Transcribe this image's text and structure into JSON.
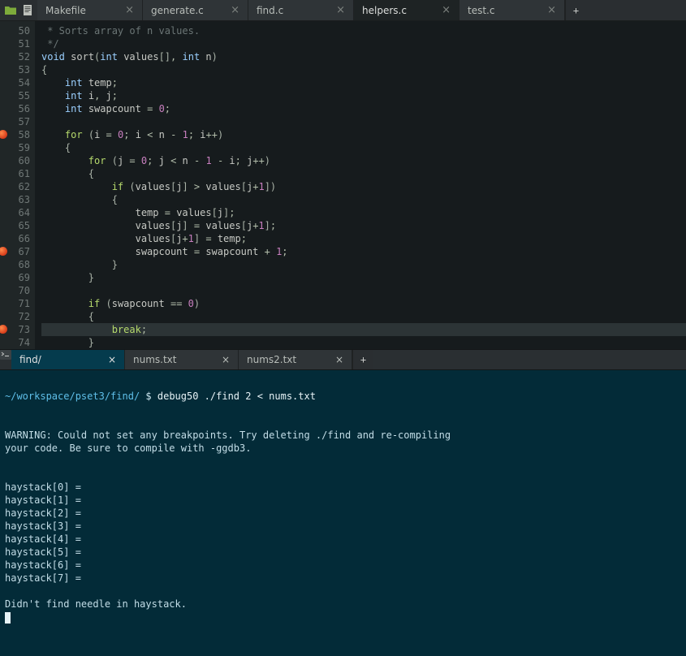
{
  "editorTabs": {
    "items": [
      {
        "label": "Makefile",
        "active": false
      },
      {
        "label": "generate.c",
        "active": false
      },
      {
        "label": "find.c",
        "active": false
      },
      {
        "label": "helpers.c",
        "active": true
      },
      {
        "label": "test.c",
        "active": false
      }
    ],
    "closeGlyph": "×",
    "addGlyph": "+"
  },
  "code": {
    "startLine": 50,
    "lines": [
      {
        "n": 50,
        "bp": false,
        "hl": false,
        "html": "<span class='c-comment'> * Sorts array of n values.</span>"
      },
      {
        "n": 51,
        "bp": false,
        "hl": false,
        "html": "<span class='c-comment'> */</span>"
      },
      {
        "n": 52,
        "bp": false,
        "hl": false,
        "html": "<span class='c-type'>void</span> <span class='c-id'>sort</span><span class='c-paren'>(</span><span class='c-type'>int</span> <span class='c-id'>values</span><span class='c-paren'>[</span><span class='c-paren'>]</span><span class='c-op'>,</span> <span class='c-type'>int</span> <span class='c-id'>n</span><span class='c-paren'>)</span>"
      },
      {
        "n": 53,
        "bp": false,
        "hl": false,
        "html": "<span class='c-paren'>{</span>"
      },
      {
        "n": 54,
        "bp": false,
        "hl": false,
        "html": "    <span class='c-type'>int</span> <span class='c-id'>temp</span><span class='c-op'>;</span>"
      },
      {
        "n": 55,
        "bp": false,
        "hl": false,
        "html": "    <span class='c-type'>int</span> <span class='c-id'>i</span><span class='c-op'>,</span> <span class='c-id'>j</span><span class='c-op'>;</span>"
      },
      {
        "n": 56,
        "bp": false,
        "hl": false,
        "html": "    <span class='c-type'>int</span> <span class='c-id'>swapcount</span> <span class='c-op'>=</span> <span class='c-num'>0</span><span class='c-op'>;</span>"
      },
      {
        "n": 57,
        "bp": false,
        "hl": false,
        "html": ""
      },
      {
        "n": 58,
        "bp": true,
        "hl": false,
        "html": "    <span class='c-kw'>for</span> <span class='c-paren'>(</span><span class='c-id'>i</span> <span class='c-op'>=</span> <span class='c-num'>0</span><span class='c-op'>;</span> <span class='c-id'>i</span> <span class='c-op'>&lt;</span> <span class='c-id'>n</span> <span class='c-op'>-</span> <span class='c-num'>1</span><span class='c-op'>;</span> <span class='c-id'>i</span><span class='c-op'>++</span><span class='c-paren'>)</span>"
      },
      {
        "n": 59,
        "bp": false,
        "hl": false,
        "html": "    <span class='c-paren'>{</span>"
      },
      {
        "n": 60,
        "bp": false,
        "hl": false,
        "html": "        <span class='c-kw'>for</span> <span class='c-paren'>(</span><span class='c-id'>j</span> <span class='c-op'>=</span> <span class='c-num'>0</span><span class='c-op'>;</span> <span class='c-id'>j</span> <span class='c-op'>&lt;</span> <span class='c-id'>n</span> <span class='c-op'>-</span> <span class='c-num'>1</span> <span class='c-op'>-</span> <span class='c-id'>i</span><span class='c-op'>;</span> <span class='c-id'>j</span><span class='c-op'>++</span><span class='c-paren'>)</span>"
      },
      {
        "n": 61,
        "bp": false,
        "hl": false,
        "html": "        <span class='c-paren'>{</span>"
      },
      {
        "n": 62,
        "bp": false,
        "hl": false,
        "html": "            <span class='c-kw'>if</span> <span class='c-paren'>(</span><span class='c-id'>values</span><span class='c-paren'>[</span><span class='c-id'>j</span><span class='c-paren'>]</span> <span class='c-op'>&gt;</span> <span class='c-id'>values</span><span class='c-paren'>[</span><span class='c-id'>j</span><span class='c-op'>+</span><span class='c-num'>1</span><span class='c-paren'>]</span><span class='c-paren'>)</span>"
      },
      {
        "n": 63,
        "bp": false,
        "hl": false,
        "html": "            <span class='c-paren'>{</span>"
      },
      {
        "n": 64,
        "bp": false,
        "hl": false,
        "html": "                <span class='c-id'>temp</span> <span class='c-op'>=</span> <span class='c-id'>values</span><span class='c-paren'>[</span><span class='c-id'>j</span><span class='c-paren'>]</span><span class='c-op'>;</span>"
      },
      {
        "n": 65,
        "bp": false,
        "hl": false,
        "html": "                <span class='c-id'>values</span><span class='c-paren'>[</span><span class='c-id'>j</span><span class='c-paren'>]</span> <span class='c-op'>=</span> <span class='c-id'>values</span><span class='c-paren'>[</span><span class='c-id'>j</span><span class='c-op'>+</span><span class='c-num'>1</span><span class='c-paren'>]</span><span class='c-op'>;</span>"
      },
      {
        "n": 66,
        "bp": false,
        "hl": false,
        "html": "                <span class='c-id'>values</span><span class='c-paren'>[</span><span class='c-id'>j</span><span class='c-op'>+</span><span class='c-num'>1</span><span class='c-paren'>]</span> <span class='c-op'>=</span> <span class='c-id'>temp</span><span class='c-op'>;</span>"
      },
      {
        "n": 67,
        "bp": true,
        "hl": false,
        "html": "                <span class='c-id'>swapcount</span> <span class='c-op'>=</span> <span class='c-id'>swapcount</span> <span class='c-op'>+</span> <span class='c-num'>1</span><span class='c-op'>;</span>"
      },
      {
        "n": 68,
        "bp": false,
        "hl": false,
        "html": "            <span class='c-paren'>}</span>"
      },
      {
        "n": 69,
        "bp": false,
        "hl": false,
        "html": "        <span class='c-paren'>}</span>"
      },
      {
        "n": 70,
        "bp": false,
        "hl": false,
        "html": ""
      },
      {
        "n": 71,
        "bp": false,
        "hl": false,
        "html": "        <span class='c-kw'>if</span> <span class='c-paren'>(</span><span class='c-id'>swapcount</span> <span class='c-op'>==</span> <span class='c-num'>0</span><span class='c-paren'>)</span>"
      },
      {
        "n": 72,
        "bp": false,
        "hl": false,
        "html": "        <span class='c-paren'>{</span>"
      },
      {
        "n": 73,
        "bp": true,
        "hl": true,
        "html": "            <span class='c-kw'>break</span><span class='c-op'>;</span>"
      },
      {
        "n": 74,
        "bp": false,
        "hl": false,
        "html": "        <span class='c-paren'>}</span>"
      }
    ]
  },
  "terminalTabs": {
    "items": [
      {
        "label": "find/",
        "active": true
      },
      {
        "label": "nums.txt",
        "active": false
      },
      {
        "label": "nums2.txt",
        "active": false
      }
    ],
    "closeGlyph": "×",
    "addGlyph": "+"
  },
  "terminal": {
    "promptPath": "~/workspace/pset3/find/",
    "promptSymbol": "$",
    "command": "debug50 ./find 2 < nums.txt",
    "output": "\n\nWARNING: Could not set any breakpoints. Try deleting ./find and re-compiling\nyour code. Be sure to compile with -ggdb3.\n\n\nhaystack[0] =\nhaystack[1] =\nhaystack[2] =\nhaystack[3] =\nhaystack[4] =\nhaystack[5] =\nhaystack[6] =\nhaystack[7] =\n\nDidn't find needle in haystack.\n"
  }
}
